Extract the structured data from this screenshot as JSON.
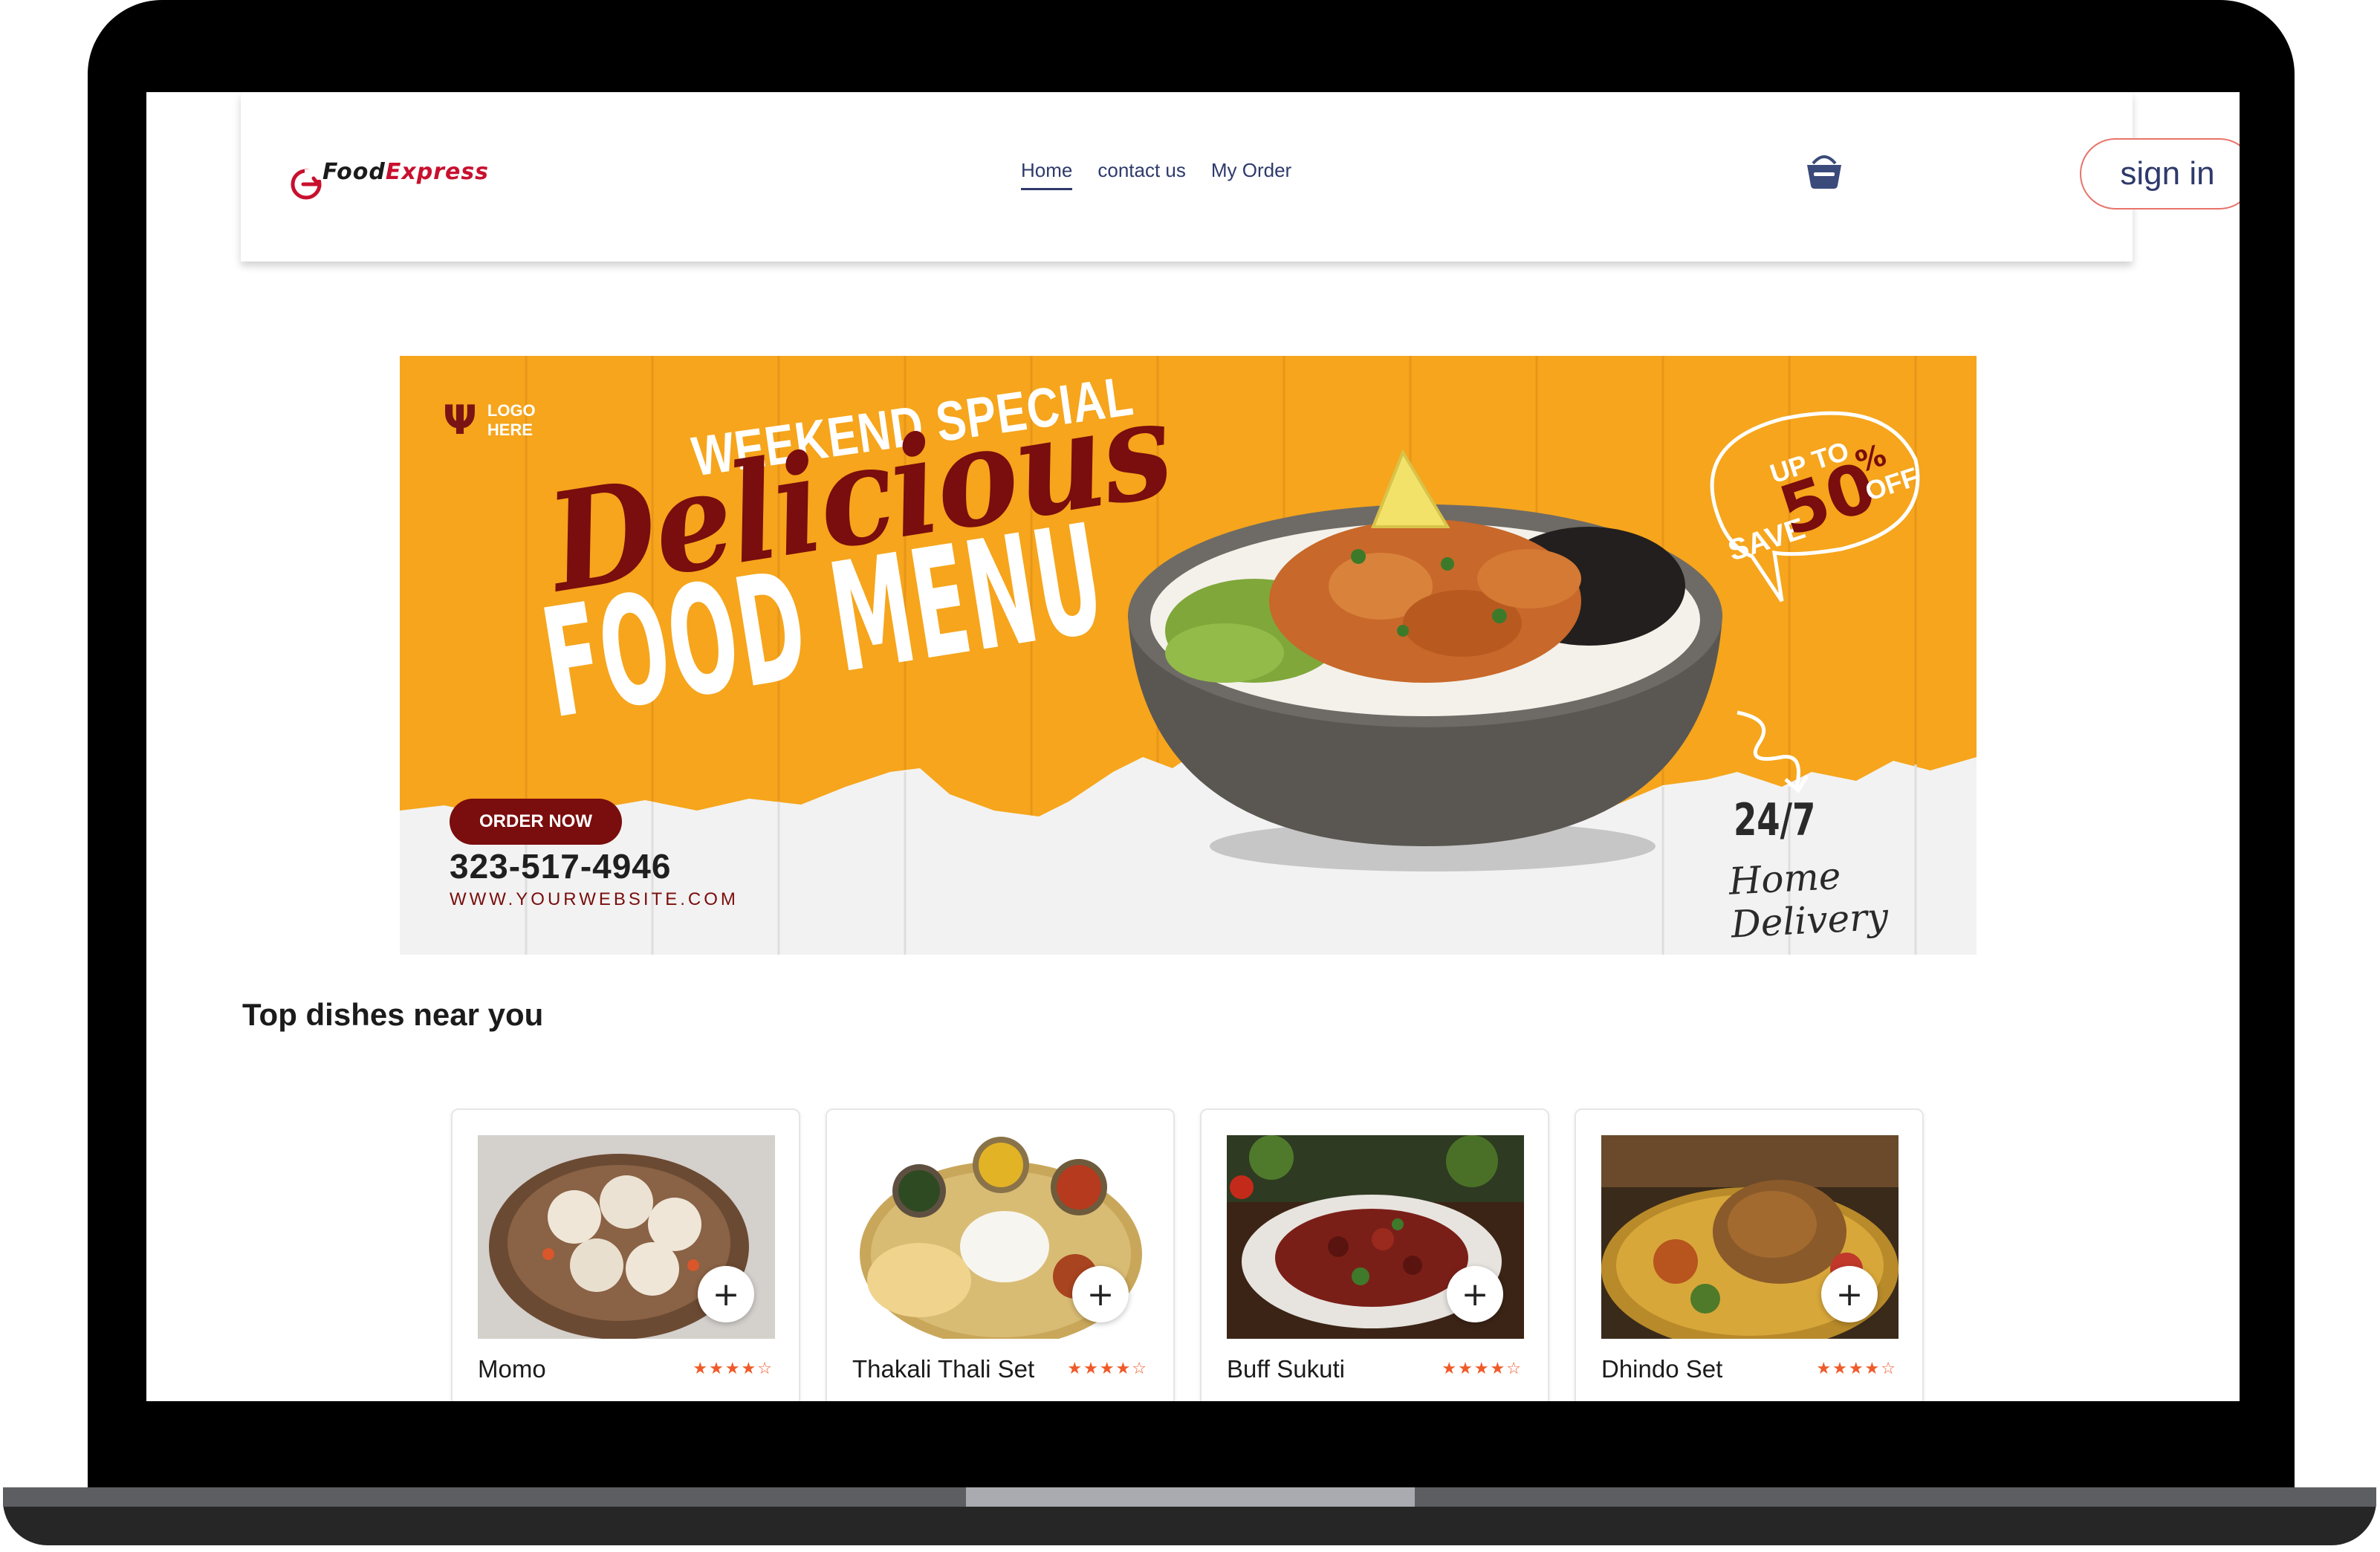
{
  "brand": {
    "name_part1": "Food",
    "name_part2": "Express",
    "colors": {
      "primary": "#c8102e",
      "nav_text": "#2e3a6b",
      "signin_border": "#e8736b",
      "star": "#f05a28"
    }
  },
  "nav": {
    "links": [
      {
        "label": "Home",
        "active": true
      },
      {
        "label": "contact us",
        "active": false
      },
      {
        "label": "My Order",
        "active": false
      }
    ],
    "cart_icon": "basket-icon",
    "signin_label": "sign in"
  },
  "banner": {
    "logo_icon": "fork-knife-icon",
    "logo_line1": "LOGO",
    "logo_line2": "HERE",
    "weekend": "WEEKEND SPECIAL",
    "headline1": "Delicious",
    "headline2": "FOOD MENU",
    "save_upto": "UP TO",
    "save_label": "SAVE",
    "save_value": "50",
    "save_percent": "%",
    "save_off": "OFF",
    "order_button": "ORDER NOW",
    "phone": "323-517-4946",
    "website": "WWW.YOURWEBSITE.COM",
    "delivery_hours": "24/7",
    "delivery_text": "Home Delivery",
    "colors": {
      "orange": "#f6a51c",
      "maroon": "#7a0d0d"
    }
  },
  "section": {
    "title": "Top dishes near you"
  },
  "dishes": [
    {
      "name": "Momo",
      "rating": 4,
      "stars": "★★★★☆",
      "add_label": "+"
    },
    {
      "name": "Thakali Thali Set",
      "rating": 4,
      "stars": "★★★★☆",
      "add_label": "+"
    },
    {
      "name": "Buff Sukuti",
      "rating": 4,
      "stars": "★★★★☆",
      "add_label": "+"
    },
    {
      "name": "Dhindo Set",
      "rating": 4,
      "stars": "★★★★☆",
      "add_label": "+"
    }
  ]
}
